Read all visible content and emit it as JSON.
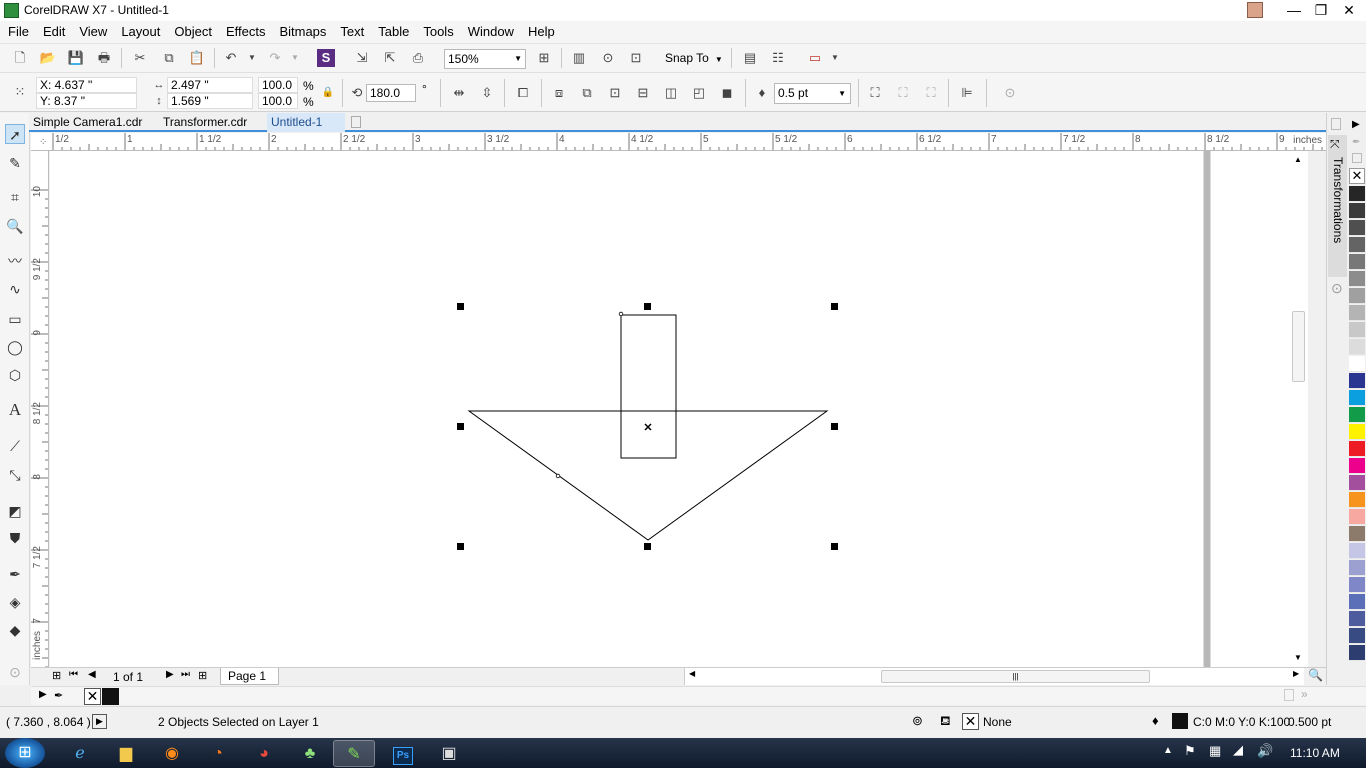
{
  "window": {
    "title": "CorelDRAW X7 - Untitled-1",
    "minimize": "—",
    "maximize": "❐",
    "close": "✕"
  },
  "menu": [
    "File",
    "Edit",
    "View",
    "Layout",
    "Object",
    "Effects",
    "Bitmaps",
    "Text",
    "Table",
    "Tools",
    "Window",
    "Help"
  ],
  "standard_toolbar": {
    "zoom": "150%",
    "snap_to": "Snap To"
  },
  "property_bar": {
    "x": "X: 4.637 \"",
    "y": "Y: 8.37 \"",
    "width": "2.497 \"",
    "height": "1.569 \"",
    "scale_x": "100.0",
    "scale_y": "100.0",
    "pct_x": "%",
    "pct_y": "%",
    "angle": "180.0",
    "degree": "°",
    "outline_width": "0.5 pt"
  },
  "tabs": [
    {
      "label": "Simple Camera1.cdr",
      "active": false
    },
    {
      "label": "Transformer.cdr",
      "active": false
    },
    {
      "label": "Untitled-1",
      "active": true
    }
  ],
  "ruler": {
    "unit": "inches",
    "h_labels": [
      "1/2",
      "1",
      "1 1/2",
      "2",
      "2 1/2",
      "3",
      "3 1/2",
      "4",
      "4 1/2",
      "5",
      "5 1/2",
      "6",
      "6 1/2",
      "7",
      "7 1/2",
      "8",
      "8 1/2",
      "9"
    ],
    "v_labels": [
      "10",
      "9 1/2",
      "9",
      "8 1/2",
      "8",
      "7 1/2",
      "7",
      "inches"
    ]
  },
  "docker": {
    "title": "Transformations"
  },
  "page_nav": {
    "count": "1 of 1",
    "page_tab": "Page 1"
  },
  "status": {
    "cursor": "( 7.360 , 8.064 )",
    "selection": "2 Objects Selected on Layer 1",
    "fill": "None",
    "outline_color": "C:0 M:0 Y:0 K:100",
    "outline_width": "0.500 pt"
  },
  "taskbar": {
    "time": "11:10 AM"
  },
  "palette_colors": [
    "#262626",
    "#3b3b3b",
    "#4f4f4f",
    "#646464",
    "#787878",
    "#8c8c8c",
    "#a0a0a0",
    "#b4b4b4",
    "#c8c8c8",
    "#dcdcdc",
    "#ffffff",
    "#2a3592",
    "#0b9fe0",
    "#129b48",
    "#fff200",
    "#ed1c24",
    "#ec008c",
    "#a34f9d",
    "#f7941d",
    "#f7a8a0",
    "#8c7a6b",
    "#c5c6e5",
    "#9ba0d0",
    "#7f87c8",
    "#5b6fb8",
    "#4e5c9e",
    "#394b83",
    "#2d3d70"
  ]
}
